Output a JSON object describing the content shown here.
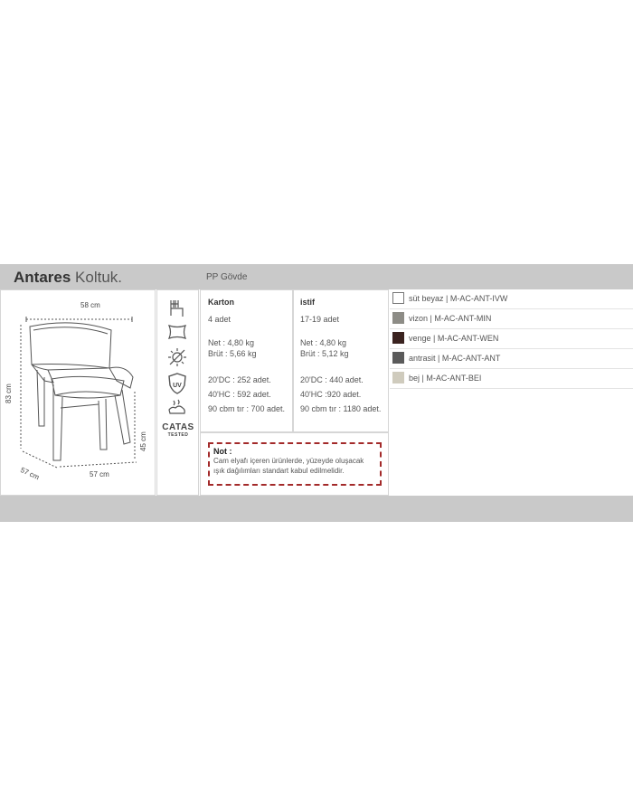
{
  "header": {
    "product_name": "Antares",
    "product_type": "Koltuk.",
    "subtitle": "PP Gövde"
  },
  "drawing": {
    "dim_width": "58 cm",
    "dim_height": "83 cm",
    "dim_seat": "45 cm",
    "dim_depth": "57 cm",
    "dim_bottom": "57 cm"
  },
  "icons": [
    {
      "name": "chair-stack-icon"
    },
    {
      "name": "cushion-icon"
    },
    {
      "name": "sun-icon"
    },
    {
      "name": "uv-shield-icon",
      "label": "UV"
    },
    {
      "name": "wash-icon"
    },
    {
      "name": "catas-tested-logo",
      "label": "CATAS",
      "sublabel": "TESTED"
    }
  ],
  "karton": {
    "heading": "Karton",
    "qty": "4 adet",
    "net": "Net     : 4,80 kg",
    "brut": "Brüt  : 5,66 kg",
    "dc20": "20'DC : 252 adet.",
    "hc40": "40'HC : 592 adet.",
    "tir": "90 cbm tır : 700 adet."
  },
  "istif": {
    "heading": "istif",
    "qty": "17-19 adet",
    "net": "Net     : 4,80 kg",
    "brut": "Brüt  : 5,12 kg",
    "dc20": "20'DC : 440 adet.",
    "hc40": "40'HC :920 adet.",
    "tir": "90 cbm tır : 1180 adet."
  },
  "note": {
    "title": "Not :",
    "line1": "Cam elyafı içeren ürünlerde, yüzeyde oluşacak",
    "line2": "ışık dağılımları standart kabul edilmelidir."
  },
  "colors": [
    {
      "label": "süt beyaz | M-AC-ANT-IVW",
      "hex": "#ffffff"
    },
    {
      "label": "vizon | M-AC-ANT-MIN",
      "hex": "#8d8c86"
    },
    {
      "label": "venge | M-AC-ANT-WEN",
      "hex": "#3b2320"
    },
    {
      "label": "antrasit | M-AC-ANT-ANT",
      "hex": "#5b5b5b"
    },
    {
      "label": "bej | M-AC-ANT-BEI",
      "hex": "#cfcbbd"
    }
  ]
}
